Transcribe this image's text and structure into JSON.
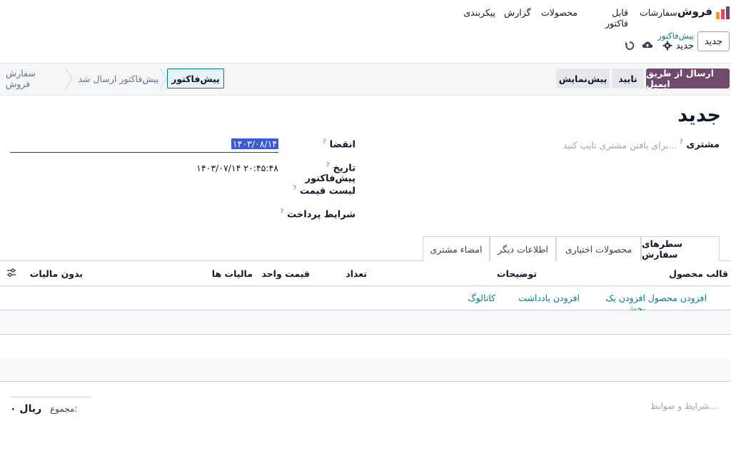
{
  "app": {
    "brand": "فروش",
    "menu": [
      "سفارشات",
      "قابل فاکتور",
      "محصولات",
      "گزارش",
      "پیکربندی"
    ],
    "brand_colors": [
      "#f43f5e",
      "#f59e0b",
      "#71496c"
    ]
  },
  "control": {
    "new_button": "جدید",
    "breadcrumb_parent": "پیش‌فاکتور",
    "breadcrumb_current": "جدید",
    "icons": [
      "gear-icon",
      "cloud-save-icon",
      "discard-icon"
    ]
  },
  "actions": {
    "send_email": "ارسال از طریق ایمیل",
    "confirm": "تایید",
    "preview": "پیش‌نمایش"
  },
  "stages": [
    "پیش‌فاکتور",
    "پیش‌فاکتور ارسال شد",
    "سفارش فروش"
  ],
  "form": {
    "title": "جدید",
    "customer_label": "مشتری",
    "customer_placeholder": "برای یافتن مشتری تایپ کنید...",
    "expiration_label": "انقضا",
    "expiration_value": "۱۴۰۳/۰۸/۱۴",
    "quote_date_label": "تاریخ پیش‌فاکتور",
    "quote_date_value": "۱۴۰۳/۰۷/۱۴ ۲۰:۴۵:۴۸",
    "pricelist_label": "لیست قیمت",
    "payment_terms_label": "شرایط پرداخت",
    "help_mark": "?"
  },
  "tabs": [
    "سطرهای سفارش",
    "محصولات اختیاری",
    "اطلاعات دیگر",
    "امضاء مشتری"
  ],
  "table": {
    "columns": [
      "قالب محصول",
      "توضیحات",
      "تعداد",
      "قیمت واحد",
      "مالیات ها",
      "بدون مالیات"
    ],
    "add_links": [
      "افزودن محصول",
      "افزودن یک بخش",
      "افزودن یادداشت",
      "کاتالوگ"
    ]
  },
  "footer": {
    "terms_placeholder": "شرایط و ضوابط...",
    "total_label": "مجموع:",
    "total_value": "ریال ۰"
  },
  "colors": {
    "primary": "#71496c",
    "link": "#017e84",
    "selection": "#3b5bd6"
  }
}
